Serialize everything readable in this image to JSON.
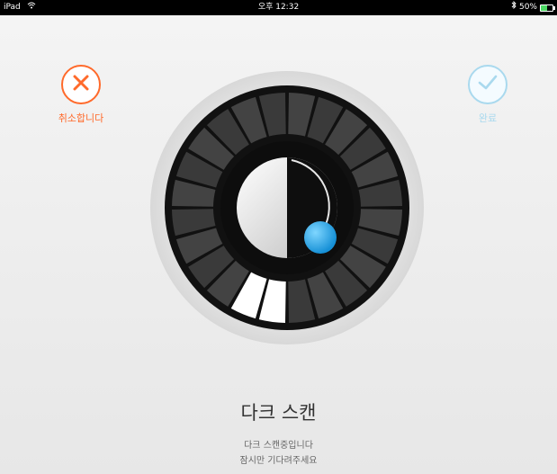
{
  "status_bar": {
    "device": "iPad",
    "time": "오후 12:32",
    "battery": "50%",
    "battery_level": 0.5
  },
  "actions": {
    "cancel_label": "취소합니다",
    "done_label": "완료"
  },
  "scan": {
    "title": "다크 스캔",
    "message_line1": "다크 스캔중입니다",
    "message_line2": "잠시만 기다려주세요",
    "segments_total": 24,
    "segments_active": 2
  },
  "colors": {
    "cancel_accent": "#ff6a2b",
    "done_accent": "#a9d9ee",
    "indicator": "#2aa8e8"
  },
  "icons": [
    "wifi-icon",
    "bluetooth-icon",
    "battery-icon",
    "close-icon",
    "checkmark-icon"
  ]
}
